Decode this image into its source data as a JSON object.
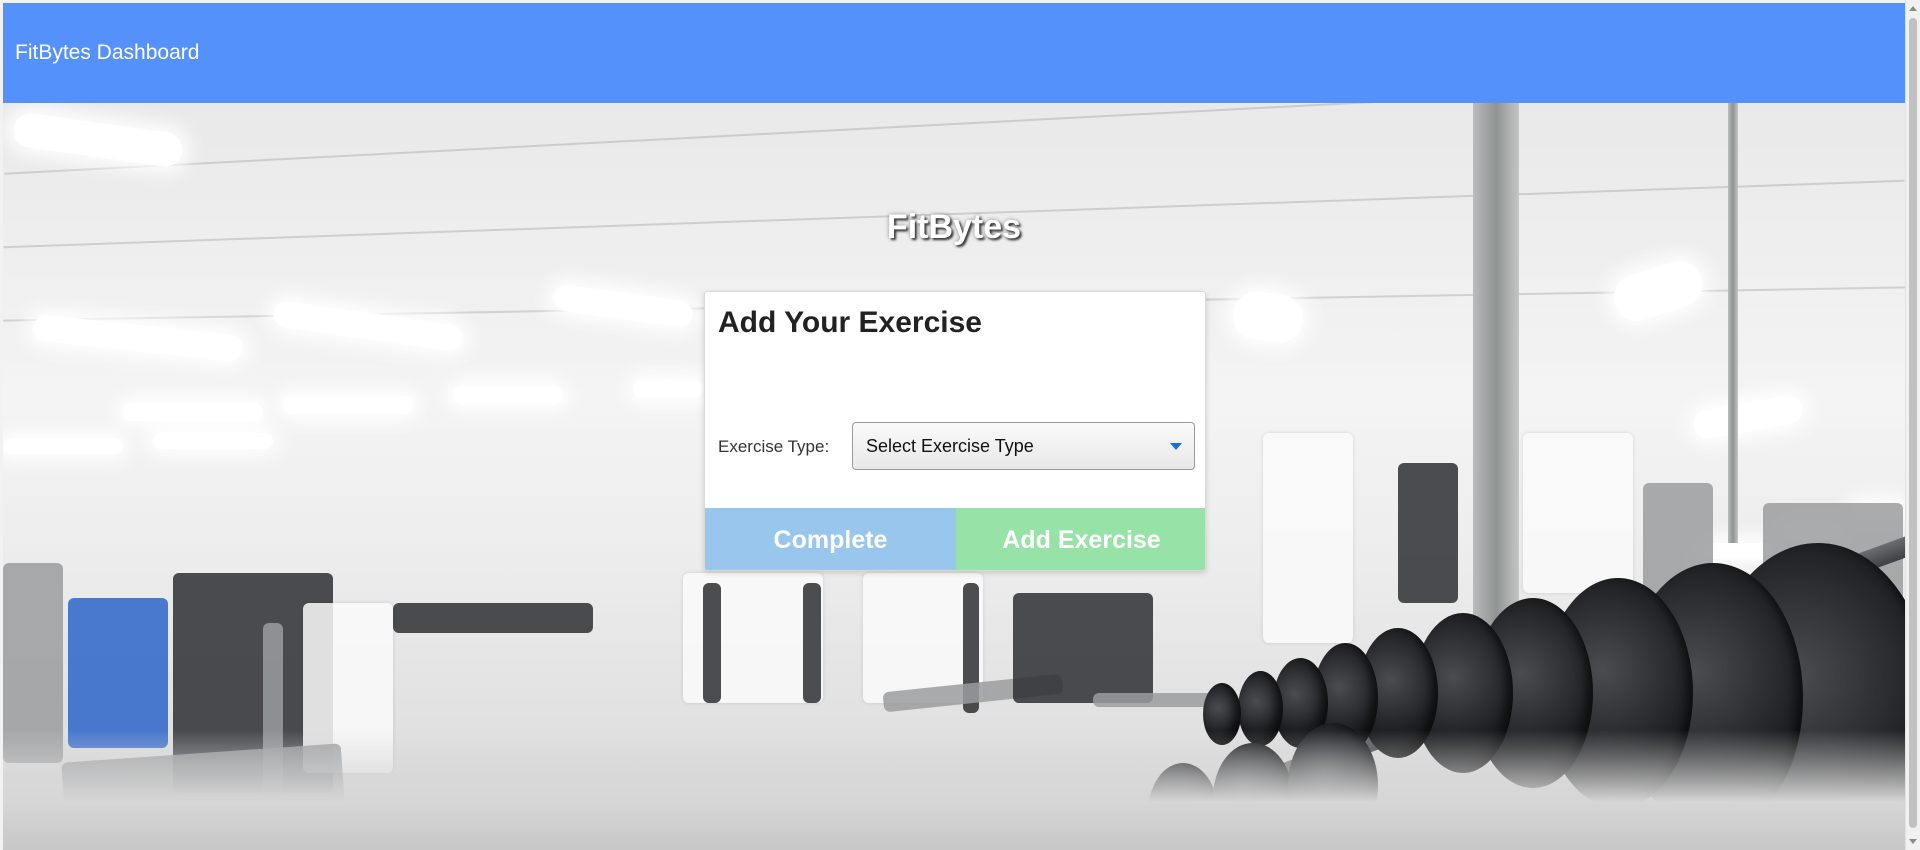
{
  "header": {
    "title": "FitBytes Dashboard",
    "background_color": "#5591fb"
  },
  "hero": {
    "brand": "FitBytes",
    "background_icon": "gym-photo"
  },
  "form": {
    "title": "Add Your Exercise",
    "exercise_type_label": "Exercise Type:",
    "exercise_type_select": {
      "selected": "Select Exercise Type",
      "arrow_icon": "caret-down-icon"
    },
    "buttons": {
      "complete_label": "Complete",
      "complete_color": "#98c6ec",
      "add_label": "Add Exercise",
      "add_color": "#97e2a7"
    }
  }
}
